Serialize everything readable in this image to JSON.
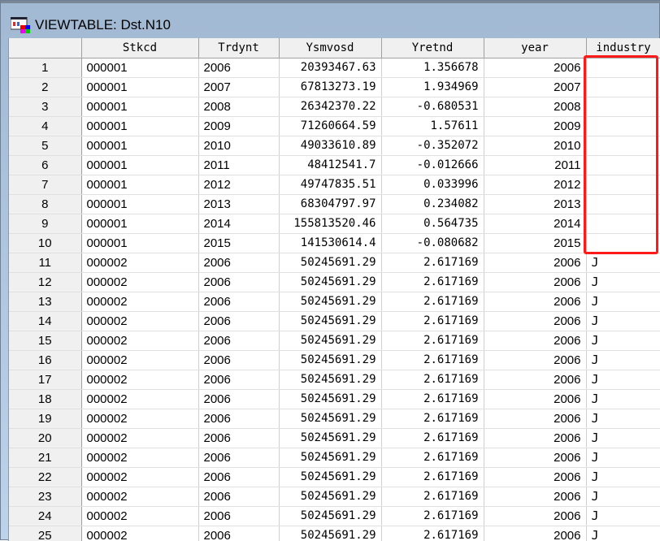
{
  "window": {
    "title": "VIEWTABLE: Dst.N10"
  },
  "columns": [
    "Stkcd",
    "Trdynt",
    "Ysmvosd",
    "Yretnd",
    "year",
    "industry"
  ],
  "rows": [
    [
      "1",
      "000001",
      "2006",
      "20393467.63",
      "1.356678",
      "2006",
      ""
    ],
    [
      "2",
      "000001",
      "2007",
      "67813273.19",
      "1.934969",
      "2007",
      ""
    ],
    [
      "3",
      "000001",
      "2008",
      "26342370.22",
      "-0.680531",
      "2008",
      ""
    ],
    [
      "4",
      "000001",
      "2009",
      "71260664.59",
      "1.57611",
      "2009",
      ""
    ],
    [
      "5",
      "000001",
      "2010",
      "49033610.89",
      "-0.352072",
      "2010",
      ""
    ],
    [
      "6",
      "000001",
      "2011",
      "48412541.7",
      "-0.012666",
      "2011",
      ""
    ],
    [
      "7",
      "000001",
      "2012",
      "49747835.51",
      "0.033996",
      "2012",
      ""
    ],
    [
      "8",
      "000001",
      "2013",
      "68304797.97",
      "0.234082",
      "2013",
      ""
    ],
    [
      "9",
      "000001",
      "2014",
      "155813520.46",
      "0.564735",
      "2014",
      ""
    ],
    [
      "10",
      "000001",
      "2015",
      "141530614.4",
      "-0.080682",
      "2015",
      ""
    ],
    [
      "11",
      "000002",
      "2006",
      "50245691.29",
      "2.617169",
      "2006",
      "J"
    ],
    [
      "12",
      "000002",
      "2006",
      "50245691.29",
      "2.617169",
      "2006",
      "J"
    ],
    [
      "13",
      "000002",
      "2006",
      "50245691.29",
      "2.617169",
      "2006",
      "J"
    ],
    [
      "14",
      "000002",
      "2006",
      "50245691.29",
      "2.617169",
      "2006",
      "J"
    ],
    [
      "15",
      "000002",
      "2006",
      "50245691.29",
      "2.617169",
      "2006",
      "J"
    ],
    [
      "16",
      "000002",
      "2006",
      "50245691.29",
      "2.617169",
      "2006",
      "J"
    ],
    [
      "17",
      "000002",
      "2006",
      "50245691.29",
      "2.617169",
      "2006",
      "J"
    ],
    [
      "18",
      "000002",
      "2006",
      "50245691.29",
      "2.617169",
      "2006",
      "J"
    ],
    [
      "19",
      "000002",
      "2006",
      "50245691.29",
      "2.617169",
      "2006",
      "J"
    ],
    [
      "20",
      "000002",
      "2006",
      "50245691.29",
      "2.617169",
      "2006",
      "J"
    ],
    [
      "21",
      "000002",
      "2006",
      "50245691.29",
      "2.617169",
      "2006",
      "J"
    ],
    [
      "22",
      "000002",
      "2006",
      "50245691.29",
      "2.617169",
      "2006",
      "J"
    ],
    [
      "23",
      "000002",
      "2006",
      "50245691.29",
      "2.617169",
      "2006",
      "J"
    ],
    [
      "24",
      "000002",
      "2006",
      "50245691.29",
      "2.617169",
      "2006",
      "J"
    ],
    [
      "25",
      "000002",
      "2006",
      "50245691.29",
      "2.617169",
      "2006",
      "J"
    ]
  ],
  "highlight_color": "#ff1a1a"
}
